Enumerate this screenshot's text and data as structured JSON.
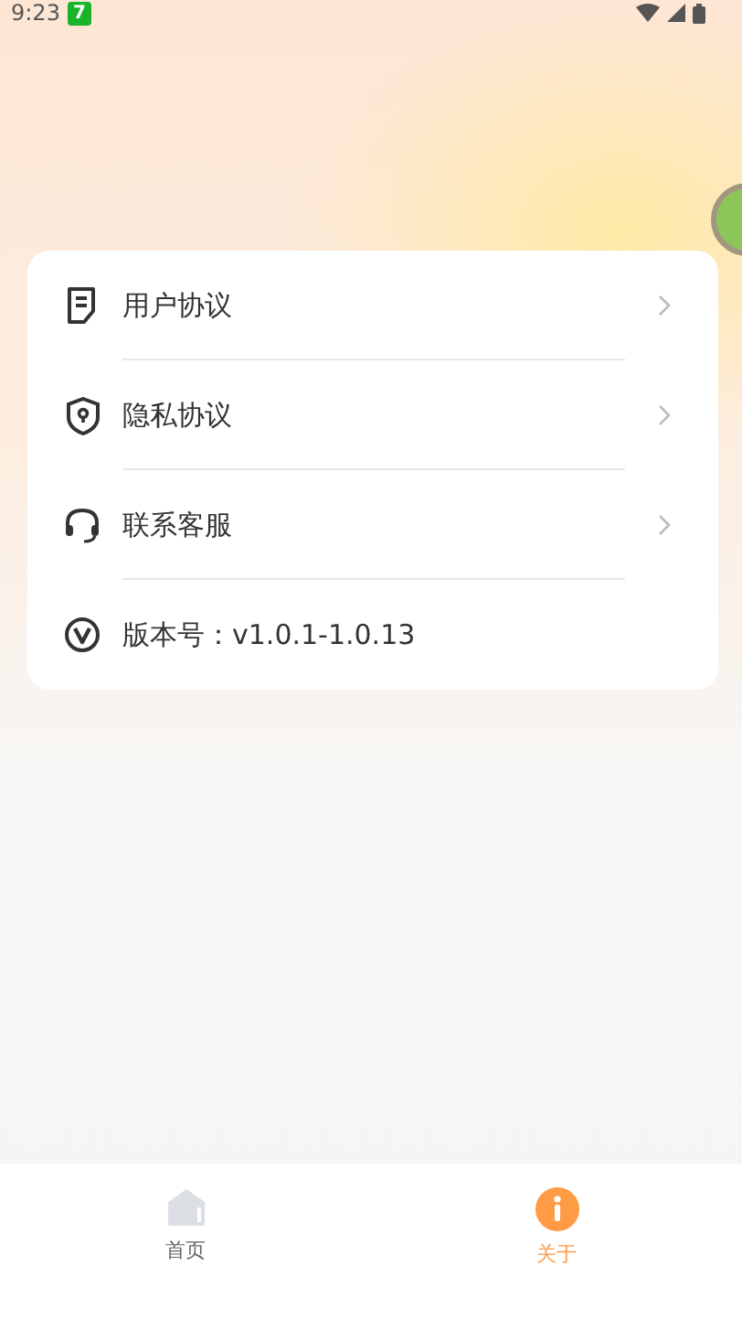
{
  "status_bar": {
    "time": "9:23",
    "notification": "7"
  },
  "menu": [
    {
      "kind": "link",
      "label": "用户协议"
    },
    {
      "kind": "link",
      "label": "隐私协议"
    },
    {
      "kind": "link",
      "label": "联系客服"
    },
    {
      "kind": "info",
      "label": "版本号：v1.0.1-1.0.13"
    }
  ],
  "tabs": [
    {
      "label": "首页",
      "selected": false
    },
    {
      "label": "关于",
      "selected": true
    }
  ]
}
